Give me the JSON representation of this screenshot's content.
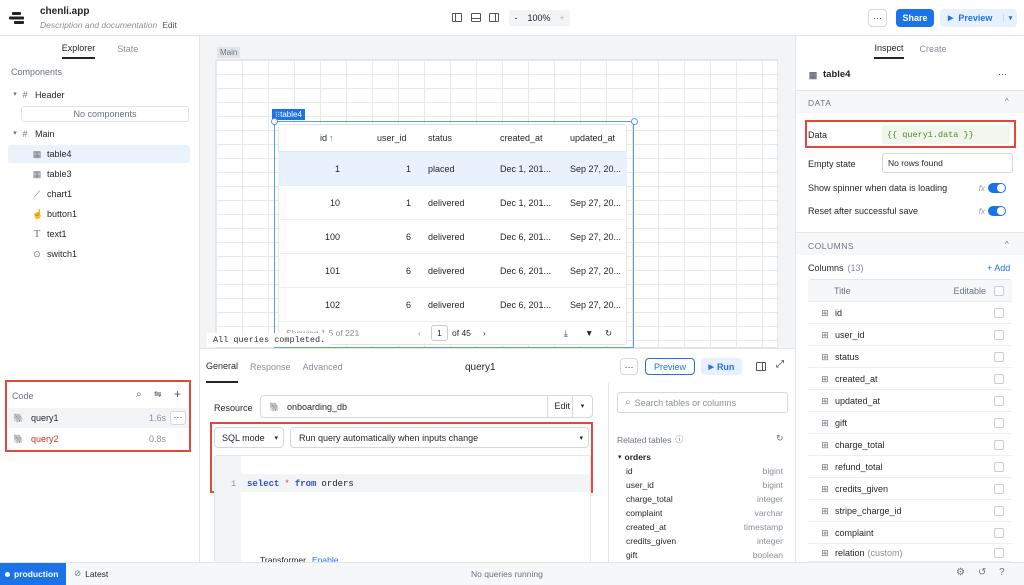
{
  "app": {
    "name": "chenli.app",
    "subtitle": "Description and documentation",
    "edit": "Edit"
  },
  "toolbar": {
    "zoom_minus": "-",
    "zoom": "100%",
    "zoom_plus": "+",
    "more": "···",
    "share": "Share",
    "preview": "Preview"
  },
  "left_tabs": [
    "Explorer",
    "State"
  ],
  "components_label": "Components",
  "tree": {
    "header": "Header",
    "no_components": "No components",
    "main": "Main",
    "items": [
      {
        "label": "table4",
        "icon": "table-icon"
      },
      {
        "label": "table3",
        "icon": "table-icon"
      },
      {
        "label": "chart1",
        "icon": "chart-icon"
      },
      {
        "label": "button1",
        "icon": "button-icon"
      },
      {
        "label": "text1",
        "icon": "text-icon"
      },
      {
        "label": "switch1",
        "icon": "switch-icon"
      }
    ]
  },
  "code": {
    "label": "Code",
    "queries": [
      {
        "name": "query1",
        "time": "1.6s"
      },
      {
        "name": "query2",
        "time": "0.8s"
      }
    ]
  },
  "canvas": {
    "main_label": "Main",
    "table_badge": "table4",
    "columns": [
      "id",
      "user_id",
      "status",
      "created_at",
      "updated_at"
    ],
    "sort_glyph": "↑",
    "rows": [
      [
        "1",
        "1",
        "placed",
        "Dec 1, 201...",
        "Sep 27, 20..."
      ],
      [
        "10",
        "1",
        "delivered",
        "Dec 1, 201...",
        "Sep 27, 20..."
      ],
      [
        "100",
        "6",
        "delivered",
        "Dec 6, 201...",
        "Sep 27, 20..."
      ],
      [
        "101",
        "6",
        "delivered",
        "Dec 6, 201...",
        "Sep 27, 20..."
      ],
      [
        "102",
        "6",
        "delivered",
        "Dec 6, 201...",
        "Sep 27, 20..."
      ]
    ],
    "footer_showing": "Showing 1-5 of 221",
    "page": "1",
    "of_pages": "of 45",
    "toast": "All queries completed."
  },
  "editor": {
    "tabs": [
      "General",
      "Response",
      "Advanced"
    ],
    "query_name": "query1",
    "preview": "Preview",
    "run": "Run",
    "resource_label": "Resource",
    "resource": "onboarding_db",
    "edit": "Edit",
    "mode": "SQL mode",
    "run_mode": "Run query automatically when inputs change",
    "line_no": "1",
    "sql_keyword1": "select",
    "sql_star": "*",
    "sql_keyword2": "from",
    "sql_table": "orders",
    "transformer": "Transformer",
    "enable": "Enable"
  },
  "schema": {
    "search_placeholder": "Search tables or columns",
    "related": "Related tables",
    "table": "orders",
    "columns": [
      {
        "name": "id",
        "type": "bigint"
      },
      {
        "name": "user_id",
        "type": "bigint"
      },
      {
        "name": "charge_total",
        "type": "integer"
      },
      {
        "name": "complaint",
        "type": "varchar"
      },
      {
        "name": "created_at",
        "type": "timestamp"
      },
      {
        "name": "credits_given",
        "type": "integer"
      },
      {
        "name": "gift",
        "type": "boolean"
      }
    ]
  },
  "inspect": {
    "tabs": [
      "Inspect",
      "Create"
    ],
    "component": "table4",
    "data_section": "DATA",
    "data_label": "Data",
    "data_value": "{{ query1.data }}",
    "empty_label": "Empty state",
    "empty_value": "No rows found",
    "spinner_label": "Show spinner when data is loading",
    "reset_label": "Reset after successful save",
    "fx": "fx",
    "columns_section": "COLUMNS",
    "columns_label": "Columns",
    "columns_count": "(13)",
    "add": "+ Add",
    "title_header": "Title",
    "editable_header": "Editable",
    "columns": [
      "id",
      "user_id",
      "status",
      "created_at",
      "updated_at",
      "gift",
      "charge_total",
      "refund_total",
      "credits_given",
      "stripe_charge_id",
      "complaint",
      "relation"
    ],
    "relation_suffix": "(custom)"
  },
  "status": {
    "env": "production",
    "latest": "Latest",
    "message": "No queries running"
  },
  "colors": {
    "accent": "#1c73e8",
    "highlight_red": "#e0483c",
    "query2_red": "#d93025"
  }
}
